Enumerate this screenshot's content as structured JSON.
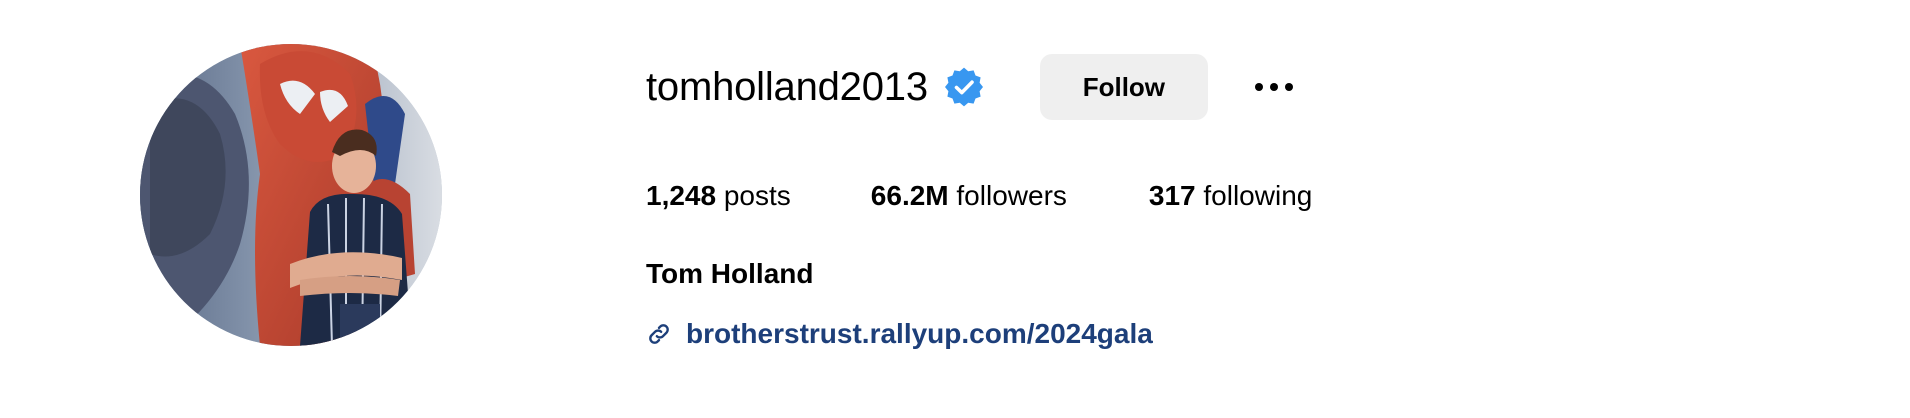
{
  "profile": {
    "username": "tomholland2013",
    "verified": true,
    "full_name": "Tom Holland",
    "link": "brotherstrust.rallyup.com/2024gala"
  },
  "actions": {
    "follow_label": "Follow"
  },
  "stats": {
    "posts_count": "1,248",
    "posts_label": "posts",
    "followers_count": "66.2M",
    "followers_label": "followers",
    "following_count": "317",
    "following_label": "following"
  },
  "colors": {
    "verified_badge": "#3897f0",
    "link": "#1d3f7a",
    "follow_button_bg": "#efefef"
  },
  "icons": {
    "verified": "verified-badge-icon",
    "more": "more-options-icon",
    "link": "link-icon"
  }
}
